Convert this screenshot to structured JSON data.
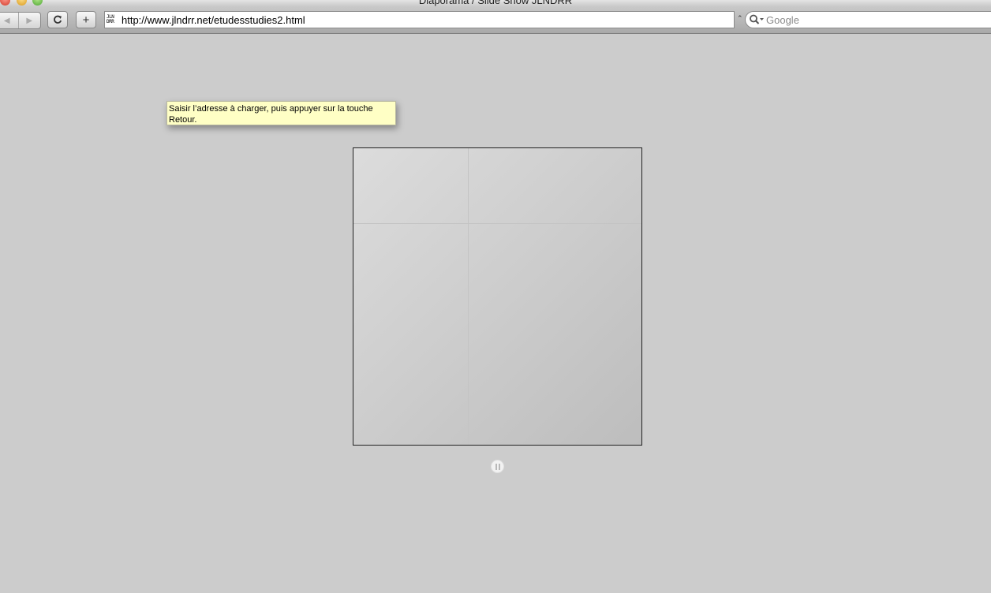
{
  "window": {
    "title": "Diaporama / Slide Show JLNDRR"
  },
  "toolbar": {
    "back_icon": "back-arrow-icon",
    "forward_icon": "forward-arrow-icon",
    "reload_icon": "reload-icon",
    "add_label": "+",
    "address": {
      "favicon_line1": "JLN",
      "favicon_line2": "DRR",
      "url": "http://www.jlndrr.net/etudesstudies2.html"
    },
    "search": {
      "placeholder": "Google",
      "value": ""
    }
  },
  "tooltip": {
    "text": "Saisir l’adresse à charger, puis appuyer sur la touche Retour."
  },
  "slideshow": {
    "state": "playing",
    "control_icon": "pause-icon"
  }
}
